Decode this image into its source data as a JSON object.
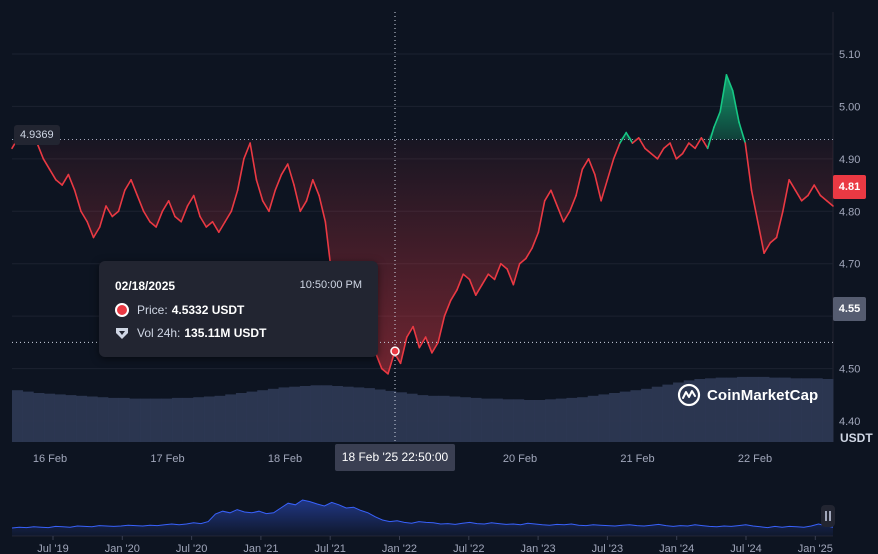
{
  "chart_data": {
    "type": "line",
    "title": "",
    "y_unit": "USDT",
    "ylim": [
      4.36,
      5.18
    ],
    "y_ticks": [
      "5.10",
      "5.00",
      "4.90",
      "4.80",
      "4.70",
      "4.60",
      "4.50",
      "4.40"
    ],
    "x_tick_labels": [
      "16 Feb",
      "17 Feb",
      "18 Feb",
      "19 Feb",
      "20 Feb",
      "21 Feb",
      "22 Feb"
    ],
    "reference_value": "4.9369",
    "last_price_label": "4.81",
    "hover_price_label": "4.55",
    "crosshair_x_label": "18 Feb '25 22:50:00",
    "colors": {
      "down": "#ea3943",
      "up": "#16c784",
      "volume": "#2f3a55",
      "navigator": "#3861fb"
    },
    "series": [
      {
        "values": [
          4.92,
          4.94,
          4.96,
          4.95,
          4.93,
          4.9,
          4.88,
          4.86,
          4.85,
          4.87,
          4.84,
          4.8,
          4.78,
          4.75,
          4.77,
          4.81,
          4.79,
          4.8,
          4.84,
          4.86,
          4.83,
          4.8,
          4.78,
          4.77,
          4.8,
          4.82,
          4.79,
          4.78,
          4.81,
          4.83,
          4.79,
          4.77,
          4.78,
          4.76,
          4.78,
          4.8,
          4.84,
          4.9,
          4.93,
          4.86,
          4.82,
          4.8,
          4.84,
          4.87,
          4.89,
          4.85,
          4.8,
          4.82,
          4.86,
          4.83,
          4.78,
          4.68,
          4.63,
          4.6,
          4.59,
          4.62,
          4.65,
          4.61,
          4.53,
          4.5,
          4.49,
          4.53,
          4.51,
          4.56,
          4.58,
          4.54,
          4.56,
          4.53,
          4.55,
          4.6,
          4.63,
          4.65,
          4.68,
          4.67,
          4.64,
          4.66,
          4.68,
          4.67,
          4.7,
          4.69,
          4.66,
          4.7,
          4.71,
          4.73,
          4.76,
          4.82,
          4.84,
          4.81,
          4.78,
          4.8,
          4.83,
          4.88,
          4.9,
          4.87,
          4.82,
          4.86,
          4.9,
          4.93,
          4.95,
          4.93,
          4.94,
          4.92,
          4.91,
          4.9,
          4.92,
          4.93,
          4.9,
          4.91,
          4.93,
          4.92,
          4.94,
          4.92,
          4.96,
          4.99,
          5.06,
          5.03,
          4.97,
          4.93,
          4.84,
          4.78,
          4.72,
          4.74,
          4.75,
          4.8,
          4.86,
          4.84,
          4.82,
          4.83,
          4.85,
          4.83,
          4.82,
          4.81
        ]
      }
    ],
    "volume": [
      0.74,
      0.72,
      0.7,
      0.69,
      0.68,
      0.67,
      0.66,
      0.65,
      0.64,
      0.63,
      0.63,
      0.62,
      0.62,
      0.62,
      0.62,
      0.63,
      0.63,
      0.64,
      0.65,
      0.66,
      0.68,
      0.7,
      0.72,
      0.74,
      0.76,
      0.78,
      0.79,
      0.8,
      0.81,
      0.81,
      0.8,
      0.79,
      0.78,
      0.77,
      0.75,
      0.73,
      0.71,
      0.69,
      0.67,
      0.66,
      0.66,
      0.65,
      0.64,
      0.63,
      0.62,
      0.62,
      0.61,
      0.61,
      0.6,
      0.6,
      0.61,
      0.62,
      0.63,
      0.64,
      0.66,
      0.68,
      0.7,
      0.72,
      0.74,
      0.76,
      0.79,
      0.82,
      0.85,
      0.88,
      0.9,
      0.91,
      0.92,
      0.92,
      0.93,
      0.93,
      0.93,
      0.92,
      0.92,
      0.91,
      0.91,
      0.91,
      0.9
    ],
    "navigator_x_labels": [
      "Jul '19",
      "Jan '20",
      "Jul '20",
      "Jan '21",
      "Jul '21",
      "Jan '22",
      "Jul '22",
      "Jan '23",
      "Jul '23",
      "Jan '24",
      "Jul '24",
      "Jan '25"
    ],
    "navigator_values": [
      0.2,
      0.22,
      0.21,
      0.23,
      0.22,
      0.21,
      0.24,
      0.23,
      0.22,
      0.25,
      0.24,
      0.23,
      0.26,
      0.25,
      0.24,
      0.25,
      0.27,
      0.26,
      0.25,
      0.27,
      0.26,
      0.28,
      0.3,
      0.28,
      0.3,
      0.33,
      0.31,
      0.36,
      0.55,
      0.62,
      0.58,
      0.66,
      0.6,
      0.58,
      0.62,
      0.56,
      0.58,
      0.7,
      0.82,
      0.78,
      0.9,
      0.86,
      0.8,
      0.75,
      0.84,
      0.78,
      0.7,
      0.72,
      0.64,
      0.58,
      0.48,
      0.4,
      0.36,
      0.38,
      0.34,
      0.32,
      0.36,
      0.34,
      0.33,
      0.3,
      0.31,
      0.29,
      0.32,
      0.34,
      0.31,
      0.3,
      0.33,
      0.31,
      0.29,
      0.3,
      0.28,
      0.32,
      0.3,
      0.28,
      0.27,
      0.29,
      0.28,
      0.3,
      0.27,
      0.26,
      0.28,
      0.27,
      0.26,
      0.25,
      0.27,
      0.28,
      0.26,
      0.25,
      0.27,
      0.29,
      0.26,
      0.24,
      0.26,
      0.25,
      0.28,
      0.26,
      0.24,
      0.23,
      0.25,
      0.24,
      0.26,
      0.28,
      0.25,
      0.23,
      0.21,
      0.24,
      0.22,
      0.24,
      0.23,
      0.22,
      0.25,
      0.3,
      0.26,
      0.22
    ]
  },
  "tooltip": {
    "date": "02/18/2025",
    "time": "10:50:00 PM",
    "price_label": "Price:",
    "price_value": "4.5332 USDT",
    "volume_label": "Vol 24h:",
    "volume_value": "135.11M USDT"
  },
  "brand": {
    "name": "CoinMarketCap"
  }
}
